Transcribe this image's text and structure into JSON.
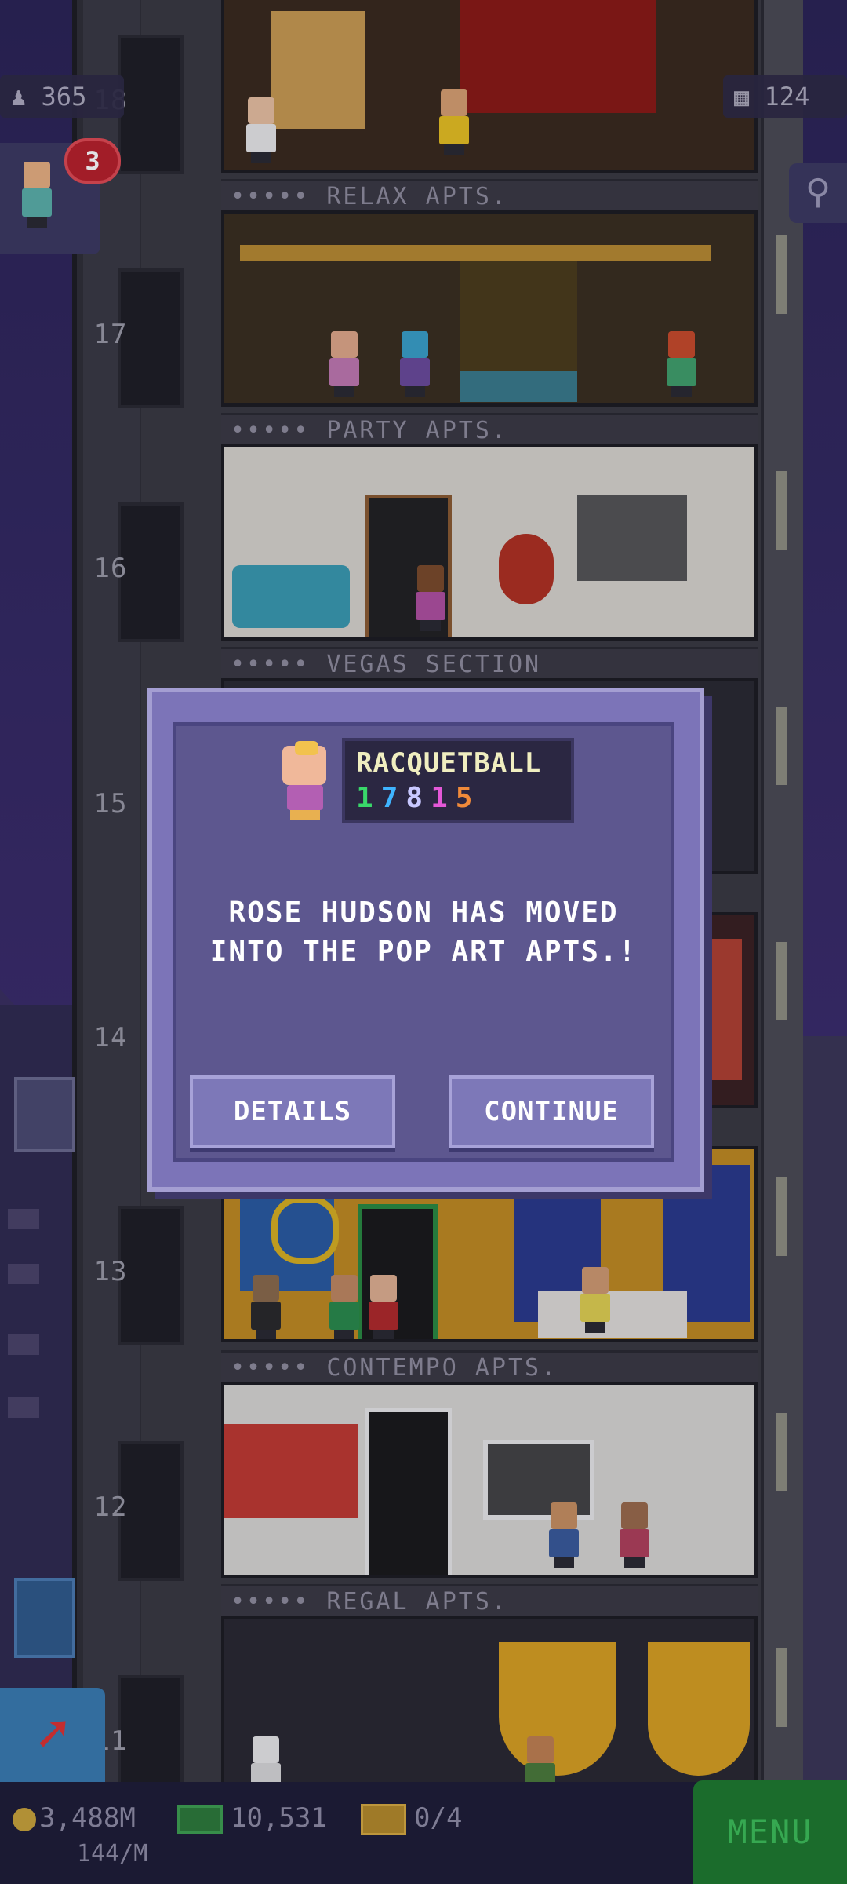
{
  "hud": {
    "population": "365",
    "floors": "124",
    "notification_count": "3"
  },
  "floors": [
    {
      "number": "18",
      "sign": "RELAX APTS."
    },
    {
      "number": "17",
      "sign": "PARTY APTS."
    },
    {
      "number": "16",
      "sign": "VEGAS SECTION"
    },
    {
      "number": "15",
      "sign": ""
    },
    {
      "number": "14",
      "sign": ""
    },
    {
      "number": "13",
      "sign": "CONTEMPO APTS."
    },
    {
      "number": "12",
      "sign": "REGAL APTS."
    },
    {
      "number": "11",
      "sign": ""
    }
  ],
  "sign_dots": "•••••",
  "dialog": {
    "skill_name": "RACQUETBALL",
    "skill_digits": [
      "1",
      "7",
      "8",
      "1",
      "5"
    ],
    "message": "ROSE HUDSON HAS MOVED INTO THE POP ART APTS.!",
    "details_label": "DETAILS",
    "continue_label": "CONTINUE"
  },
  "bottom": {
    "coins": "3,488M",
    "bux": "10,531",
    "tickets": "0/4",
    "rate": "144/M",
    "menu_label": "MENU"
  },
  "colors": {
    "dialog_bg": "#7c74b8",
    "menu_green": "#1e7a2e",
    "badge_red": "#b8202a"
  }
}
